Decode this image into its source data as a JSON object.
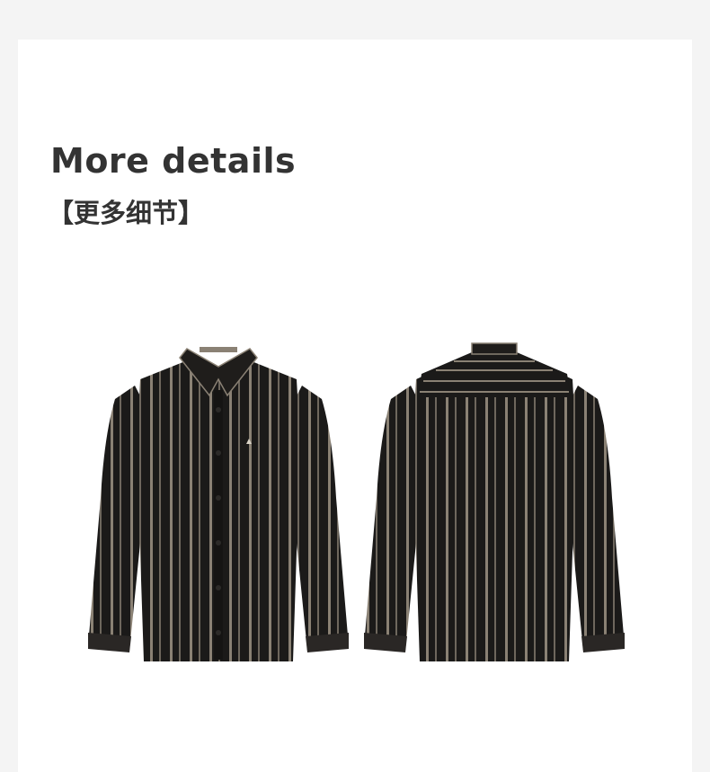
{
  "section": {
    "title": "More details",
    "subtitle": "【更多细节】"
  },
  "products": {
    "front_view": {
      "icon": "shirt-front-icon"
    },
    "back_view": {
      "icon": "shirt-back-icon"
    }
  },
  "colors": {
    "page_background": "#f4f4f4",
    "card_background": "#ffffff",
    "heading_text": "#333333",
    "shirt_base": "#1b1a19",
    "shirt_stripe": "#8a8174"
  }
}
